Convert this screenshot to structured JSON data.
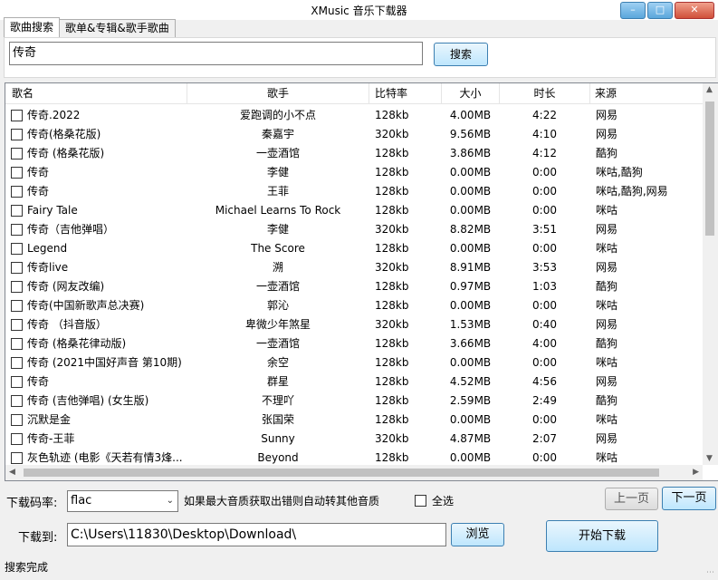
{
  "window": {
    "title": "XMusic 音乐下载器",
    "min_icon": "minimize-icon",
    "max_icon": "maximize-icon",
    "close_icon": "close-icon"
  },
  "tabs": [
    {
      "label": "歌曲搜索"
    },
    {
      "label": "歌单&专辑&歌手歌曲"
    }
  ],
  "search": {
    "value": "传奇",
    "button_label": "搜索"
  },
  "table": {
    "headers": {
      "name": "歌名",
      "singer": "歌手",
      "bitrate": "比特率",
      "size": "大小",
      "duration": "时长",
      "source": "来源"
    },
    "rows": [
      {
        "name": "传奇.2022",
        "singer": "爱跑调的小不点",
        "bitrate": "128kb",
        "size": "4.00MB",
        "duration": "4:22",
        "source": "网易"
      },
      {
        "name": "传奇(格桑花版)",
        "singer": "秦嘉宇",
        "bitrate": "320kb",
        "size": "9.56MB",
        "duration": "4:10",
        "source": "网易"
      },
      {
        "name": "传奇 (格桑花版)",
        "singer": "一壶酒馆",
        "bitrate": "128kb",
        "size": "3.86MB",
        "duration": "4:12",
        "source": "酷狗"
      },
      {
        "name": "传奇",
        "singer": "李健",
        "bitrate": "128kb",
        "size": "0.00MB",
        "duration": "0:00",
        "source": "咪咕,酷狗"
      },
      {
        "name": "传奇",
        "singer": "王菲",
        "bitrate": "128kb",
        "size": "0.00MB",
        "duration": "0:00",
        "source": "咪咕,酷狗,网易"
      },
      {
        "name": "Fairy Tale",
        "singer": "Michael Learns To Rock",
        "bitrate": "128kb",
        "size": "0.00MB",
        "duration": "0:00",
        "source": "咪咕"
      },
      {
        "name": "传奇（吉他弹唱）",
        "singer": "李健",
        "bitrate": "320kb",
        "size": "8.82MB",
        "duration": "3:51",
        "source": "网易"
      },
      {
        "name": "Legend",
        "singer": "The Score",
        "bitrate": "128kb",
        "size": "0.00MB",
        "duration": "0:00",
        "source": "咪咕"
      },
      {
        "name": "传奇live",
        "singer": "溯",
        "bitrate": "320kb",
        "size": "8.91MB",
        "duration": "3:53",
        "source": "网易"
      },
      {
        "name": "传奇 (网友改编)",
        "singer": "一壶酒馆",
        "bitrate": "128kb",
        "size": "0.97MB",
        "duration": "1:03",
        "source": "酷狗"
      },
      {
        "name": "传奇(中国新歌声总决赛)",
        "singer": "郭沁",
        "bitrate": "128kb",
        "size": "0.00MB",
        "duration": "0:00",
        "source": "咪咕"
      },
      {
        "name": "传奇 （抖音版）",
        "singer": "卑微少年煞星",
        "bitrate": "320kb",
        "size": "1.53MB",
        "duration": "0:40",
        "source": "网易"
      },
      {
        "name": "传奇 (格桑花律动版)",
        "singer": "一壶酒馆",
        "bitrate": "128kb",
        "size": "3.66MB",
        "duration": "4:00",
        "source": "酷狗"
      },
      {
        "name": "传奇 (2021中国好声音 第10期)",
        "singer": "余空",
        "bitrate": "128kb",
        "size": "0.00MB",
        "duration": "0:00",
        "source": "咪咕"
      },
      {
        "name": "传奇",
        "singer": "群星",
        "bitrate": "128kb",
        "size": "4.52MB",
        "duration": "4:56",
        "source": "网易"
      },
      {
        "name": "传奇 (吉他弹唱) (女生版)",
        "singer": "不理吖",
        "bitrate": "128kb",
        "size": "2.59MB",
        "duration": "2:49",
        "source": "酷狗"
      },
      {
        "name": "沉默是金",
        "singer": "张国荣",
        "bitrate": "128kb",
        "size": "0.00MB",
        "duration": "0:00",
        "source": "咪咕"
      },
      {
        "name": "传奇-王菲",
        "singer": "Sunny",
        "bitrate": "320kb",
        "size": "4.87MB",
        "duration": "2:07",
        "source": "网易"
      },
      {
        "name": "灰色轨迹 (电影《天若有情3烽...",
        "singer": "Beyond",
        "bitrate": "128kb",
        "size": "0.00MB",
        "duration": "0:00",
        "source": "咪咕"
      }
    ]
  },
  "controls": {
    "rate_label": "下载码率:",
    "rate_value": "flac",
    "rate_note": "如果最大音质获取出错则自动转其他音质",
    "select_all_label": "全选",
    "prev_label": "上一页",
    "next_label": "下一页",
    "download_to_label": "下载到:",
    "path_value": "C:\\Users\\11830\\Desktop\\Download\\",
    "browse_label": "浏览",
    "start_label": "开始下载"
  },
  "status": {
    "text": "搜索完成"
  }
}
